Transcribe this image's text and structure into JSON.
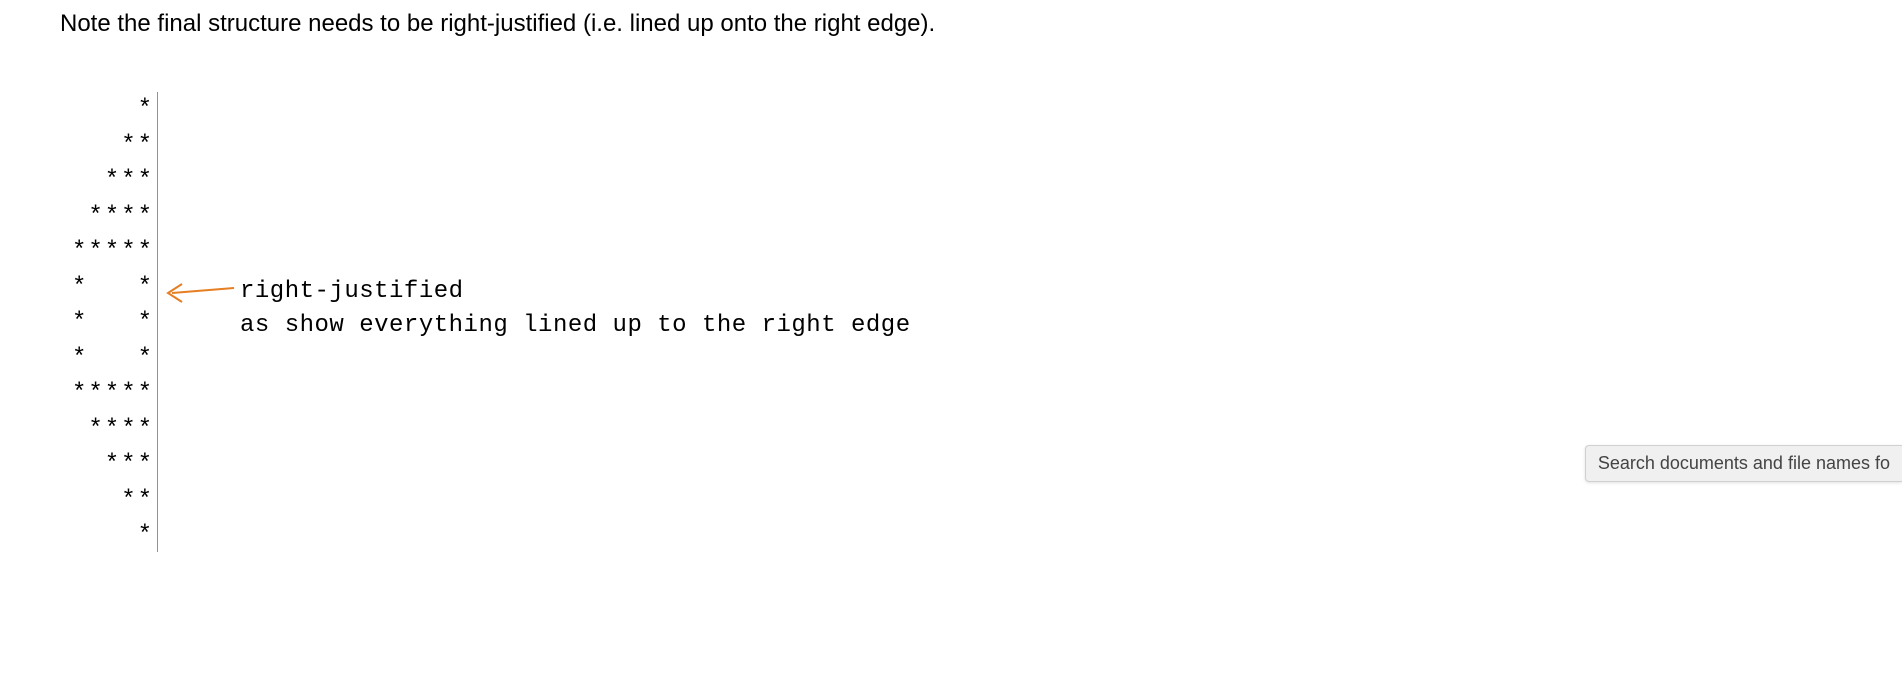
{
  "instruction_text": "Note the final structure needs to be right-justified (i.e. lined up onto the right edge).",
  "pattern": {
    "lines": [
      "*",
      "**",
      "***",
      "****",
      "*****",
      "*   *",
      "*   *",
      "*   *",
      "*****",
      "****",
      "***",
      "**",
      "*"
    ]
  },
  "annotation": {
    "line1": "right-justified",
    "line2": "as show everything lined up to the right edge"
  },
  "colors": {
    "accent": "#e67e22"
  },
  "tooltip": {
    "text": "Search documents and file names fo"
  }
}
